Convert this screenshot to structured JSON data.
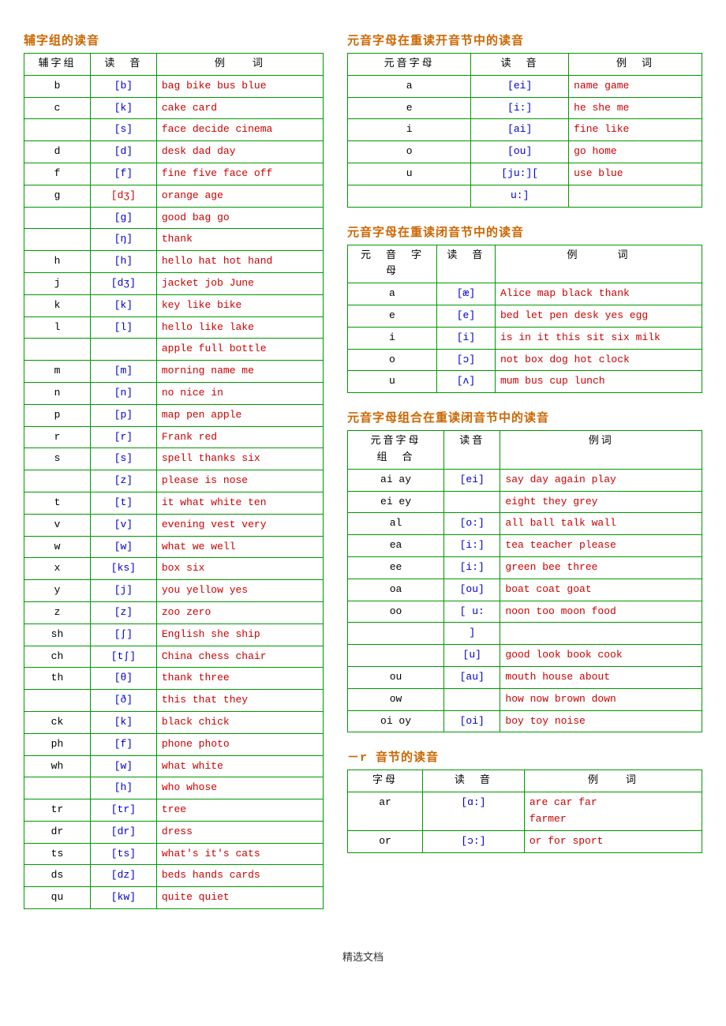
{
  "leftTable": {
    "title": "辅字组的读音",
    "headers": [
      "辅字组",
      "读　音",
      "例　　词"
    ],
    "rows": [
      {
        "char": "b",
        "phonetic": "[b]",
        "example": "bag bike bus blue",
        "exColors": [
          "r",
          "r",
          "r",
          "r"
        ]
      },
      {
        "char": "c",
        "phonetic": "[k]",
        "example": "cake  card",
        "exColors": [
          "r",
          "r"
        ]
      },
      {
        "char": "",
        "phonetic": "[s]",
        "example": "face decide cinema",
        "exColors": [
          "r",
          "r",
          "r"
        ]
      },
      {
        "char": "d",
        "phonetic": "[d]",
        "example": "desk dad day",
        "exColors": [
          "r",
          "r",
          "r"
        ]
      },
      {
        "char": "f",
        "phonetic": "[f]",
        "example": "fine five face off",
        "exColors": [
          "r",
          "r",
          "r",
          "r"
        ]
      },
      {
        "char": "g",
        "phonetic": "[dʒ]",
        "example": "orange age",
        "exColors": [
          "r",
          "r"
        ],
        "phoneticColor": "r"
      },
      {
        "char": "",
        "phonetic": "[g]",
        "example": "good bag go",
        "exColors": [
          "r",
          "r",
          "r"
        ]
      },
      {
        "char": "",
        "phonetic": "[ŋ]",
        "example": "thank",
        "exColors": [
          "k"
        ]
      },
      {
        "char": "h",
        "phonetic": "[h]",
        "example": "hello hat hot hand",
        "exColors": [
          "r",
          "r",
          "r",
          "r"
        ]
      },
      {
        "char": "j",
        "phonetic": "[dʒ]",
        "example": "jacket job June",
        "exColors": [
          "r",
          "r",
          "r"
        ]
      },
      {
        "char": "k",
        "phonetic": "[k]",
        "example": "key like bike",
        "exColors": [
          "r",
          "r",
          "r"
        ]
      },
      {
        "char": "l",
        "phonetic": "[l]",
        "example": "hello like lake",
        "exColors": [
          "r",
          "r",
          "r"
        ]
      },
      {
        "char": "",
        "phonetic": "",
        "example": "apple full bottle",
        "exColors": [
          "r",
          "r",
          "r"
        ]
      },
      {
        "char": "m",
        "phonetic": "[m]",
        "example": "morning name me",
        "exColors": [
          "r",
          "r",
          "r"
        ]
      },
      {
        "char": "n",
        "phonetic": "[n]",
        "example": "no nice in",
        "exColors": [
          "r",
          "r",
          "r"
        ]
      },
      {
        "char": "p",
        "phonetic": "[p]",
        "example": "map pen apple",
        "exColors": [
          "r",
          "r",
          "r"
        ]
      },
      {
        "char": "r",
        "phonetic": "[r]",
        "example": "Frank red",
        "exColors": [
          "k",
          "r"
        ]
      },
      {
        "char": "s",
        "phonetic": "[s]",
        "example": "spell thanks six",
        "exColors": [
          "r",
          "r",
          "r"
        ]
      },
      {
        "char": "",
        "phonetic": "[z]",
        "example": "please is nose",
        "exColors": [
          "r",
          "r",
          "r"
        ]
      },
      {
        "char": "t",
        "phonetic": "[t]",
        "example": "it what white ten",
        "exColors": [
          "r",
          "r",
          "r",
          "r"
        ]
      },
      {
        "char": "v",
        "phonetic": "[v]",
        "example": "evening vest very",
        "exColors": [
          "r",
          "r",
          "r"
        ]
      },
      {
        "char": "w",
        "phonetic": "[w]",
        "example": "what we well",
        "exColors": [
          "r",
          "r",
          "r"
        ]
      },
      {
        "char": "x",
        "phonetic": "[ks]",
        "example": "box six",
        "exColors": [
          "r",
          "r"
        ]
      },
      {
        "char": "y",
        "phonetic": "[j]",
        "example": "you yellow yes",
        "exColors": [
          "r",
          "r",
          "r"
        ]
      },
      {
        "char": "z",
        "phonetic": "[z]",
        "example": "zoo zero",
        "exColors": [
          "r",
          "r"
        ]
      },
      {
        "char": "sh",
        "phonetic": "[ʃ]",
        "example": "English she ship",
        "exColors": [
          "r",
          "r",
          "r"
        ]
      },
      {
        "char": "ch",
        "phonetic": "[tʃ]",
        "example": "China chess chair",
        "exColors": [
          "r",
          "r",
          "r"
        ]
      },
      {
        "char": "th",
        "phonetic": "[θ]",
        "example": "thank three",
        "exColors": [
          "r",
          "r"
        ]
      },
      {
        "char": "",
        "phonetic": "[ð]",
        "example": "this that they",
        "exColors": [
          "r",
          "r",
          "r"
        ],
        "phoneticColor": "b"
      },
      {
        "char": "ck",
        "phonetic": "[k]",
        "example": "black chick",
        "exColors": [
          "r",
          "r"
        ]
      },
      {
        "char": "ph",
        "phonetic": "[f]",
        "example": "phone photo",
        "exColors": [
          "r",
          "r"
        ]
      },
      {
        "char": "wh",
        "phonetic": "[w]",
        "example": "what  white",
        "exColors": [
          "r",
          "r"
        ],
        "phoneticColor": "b"
      },
      {
        "char": "",
        "phonetic": "[h]",
        "example": "who whose",
        "exColors": [
          "r",
          "r"
        ]
      },
      {
        "char": "tr",
        "phonetic": "[tr]",
        "example": "tree",
        "exColors": [
          "r"
        ]
      },
      {
        "char": "dr",
        "phonetic": "[dr]",
        "example": "dress",
        "exColors": [
          "r"
        ]
      },
      {
        "char": "ts",
        "phonetic": "[ts]",
        "example": "what's it's cats",
        "exColors": [
          "r",
          "r",
          "r",
          "r"
        ]
      },
      {
        "char": "ds",
        "phonetic": "[dz]",
        "example": "beds hands cards",
        "exColors": [
          "r",
          "r",
          "r"
        ]
      },
      {
        "char": "qu",
        "phonetic": "[kw]",
        "example": "quite  quiet",
        "exColors": [
          "r",
          "r"
        ]
      }
    ]
  },
  "rightTables": {
    "table1": {
      "title": "元音字母在重读开音节中的读音",
      "headers": [
        "元音字母",
        "读　音",
        "例　词"
      ],
      "rows": [
        {
          "char": "a",
          "phonetic": "[ei]",
          "example": "name game"
        },
        {
          "char": "e",
          "phonetic": "[i:]",
          "example": "he she me"
        },
        {
          "char": "i",
          "phonetic": "[ai]",
          "example": "fine like"
        },
        {
          "char": "o",
          "phonetic": "[ou]",
          "example": "go home"
        },
        {
          "char": "u",
          "phonetic": "[ju:][",
          "example": "use blue"
        },
        {
          "char": "",
          "phonetic": "u:]",
          "example": ""
        }
      ]
    },
    "table2": {
      "title": "元音字母在重读闭音节中的读音",
      "headers": [
        "元　音　字\n母",
        "读　音",
        "例　　　词"
      ],
      "rows": [
        {
          "char": "a",
          "phonetic": "[æ]",
          "example": "Alice map black thank"
        },
        {
          "char": "e",
          "phonetic": "[e]",
          "example": "bed let pen desk yes egg"
        },
        {
          "char": "i",
          "phonetic": "[i]",
          "example": "is in it this sit six milk"
        },
        {
          "char": "o",
          "phonetic": "[ɔ]",
          "example": "not box dog hot clock"
        },
        {
          "char": "u",
          "phonetic": "[ʌ]",
          "example": "mum bus cup lunch"
        }
      ]
    },
    "table3": {
      "title": "元音字母组合在重读闭音节中的读音",
      "headers": [
        "元音字母\n组　合",
        "读音",
        "例词"
      ],
      "rows": [
        {
          "char": "ai ay",
          "phonetic": "[ei]",
          "example": "say day again play"
        },
        {
          "char": "ei ey",
          "phonetic": "",
          "example": "eight they grey"
        },
        {
          "char": "al",
          "phonetic": "[o:]",
          "example": "all ball talk wall"
        },
        {
          "char": "ea",
          "phonetic": "[i:]",
          "example": "tea teacher please"
        },
        {
          "char": "ee",
          "phonetic": "[i:]",
          "example": "green bee three"
        },
        {
          "char": "oa",
          "phonetic": "[ou]",
          "example": "boat coat goat"
        },
        {
          "char": "oo",
          "phonetic": "[ u:",
          "example": "noon too moon food"
        },
        {
          "char": "",
          "phonetic": "]",
          "example": ""
        },
        {
          "char": "",
          "phonetic": "[u]",
          "example": "good look book cook"
        },
        {
          "char": "ou",
          "phonetic": "[au]",
          "example": "mouth house about"
        },
        {
          "char": "ow",
          "phonetic": "",
          "example": "how now brown down"
        },
        {
          "char": "oi oy",
          "phonetic": "[oi]",
          "example": "boy toy noise"
        }
      ]
    },
    "table4": {
      "title": "－r 音节的读音",
      "headers": [
        "字母",
        "读　音",
        "例　　词"
      ],
      "rows": [
        {
          "char": "ar",
          "phonetic": "[ɑ:]",
          "example": "are  car  far farmer"
        },
        {
          "char": "or",
          "phonetic": "[ɔ:]",
          "example": "or   for  sport"
        }
      ]
    }
  },
  "footer": "精选文档"
}
